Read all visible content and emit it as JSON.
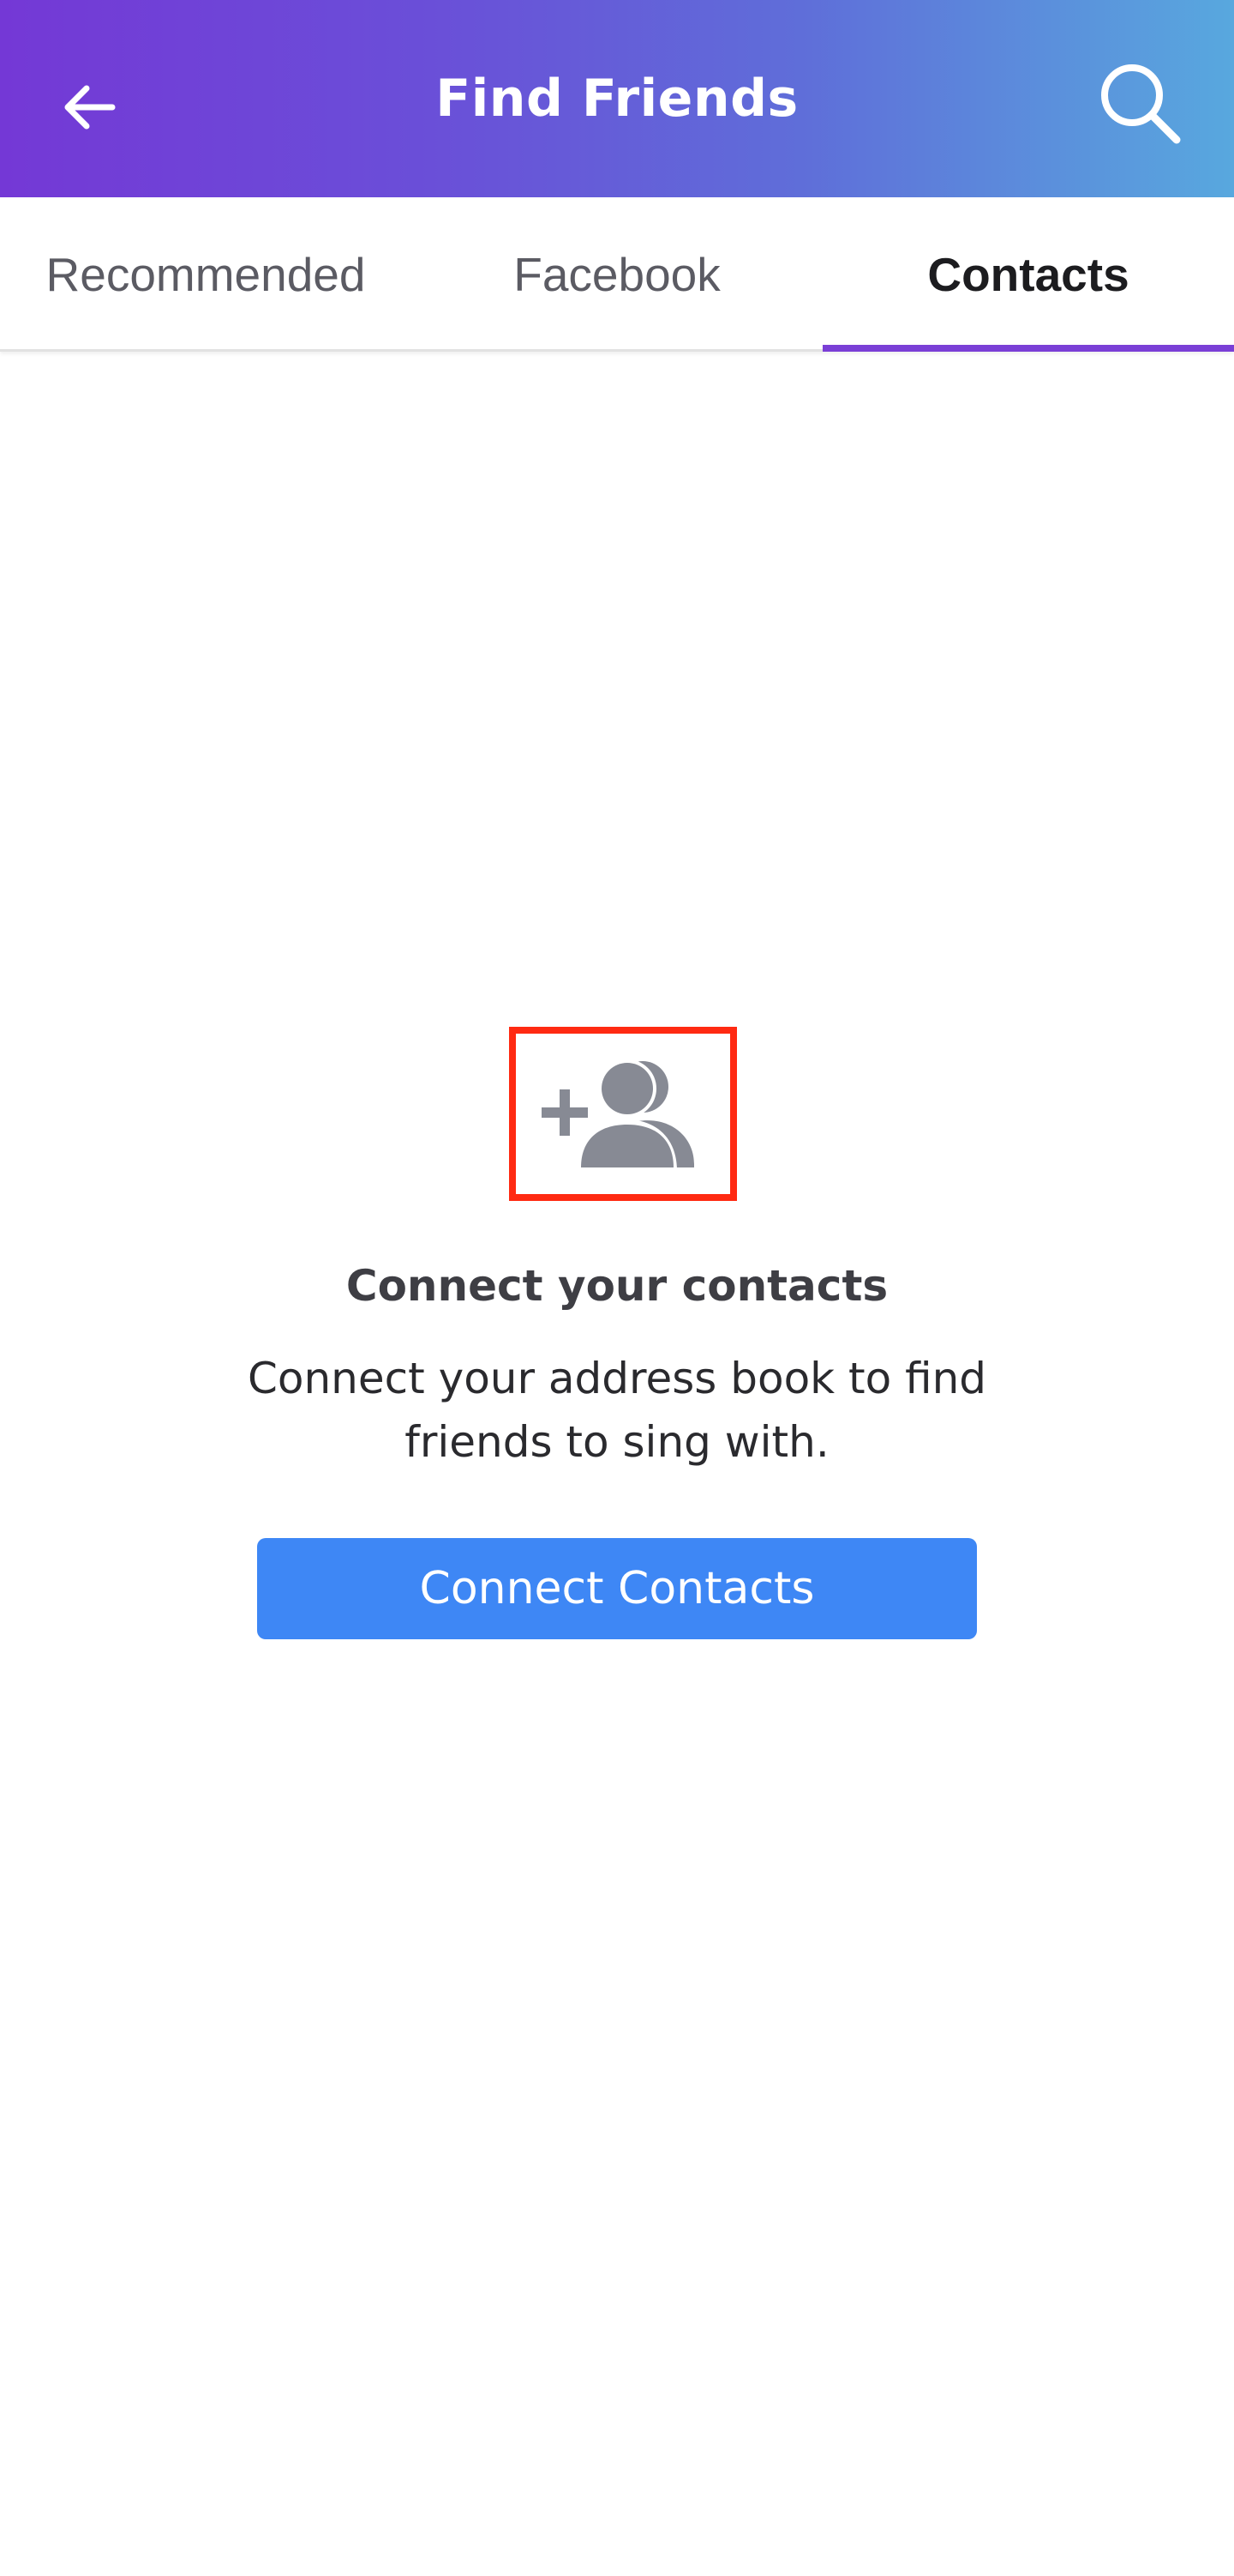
{
  "header": {
    "title": "Find Friends",
    "back_icon": "arrow-left-icon",
    "search_icon": "search-icon"
  },
  "tabs": [
    {
      "label": "Recommended",
      "selected": false
    },
    {
      "label": "Facebook",
      "selected": false
    },
    {
      "label": "Contacts",
      "selected": true
    }
  ],
  "empty_state": {
    "icon": "add-users-icon",
    "title": "Connect your contacts",
    "body_line1": "Connect your address book to find",
    "body_line2": "friends to sing with.",
    "button_label": "Connect Contacts"
  },
  "colors": {
    "header_gradient_start": "#7438d6",
    "header_gradient_end": "#58a8de",
    "tab_indicator": "#7a3fd6",
    "button": "#3e87f5",
    "highlight_box": "#ff2a12",
    "icon_gray": "#878a94"
  }
}
